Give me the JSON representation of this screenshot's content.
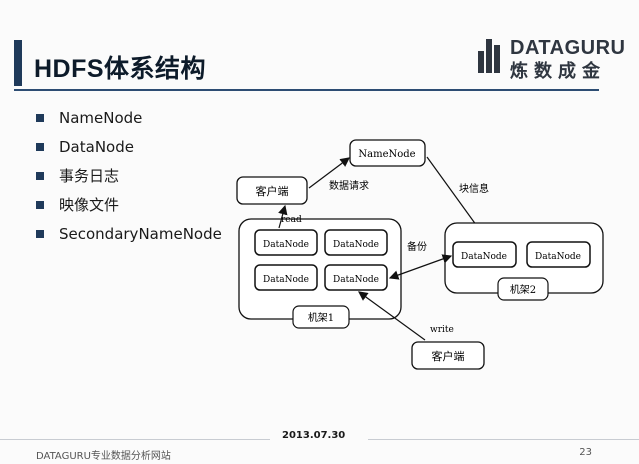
{
  "slide": {
    "title": "HDFS体系结构",
    "logo_text": "DATAGURU",
    "logo_cn": "炼数成金",
    "bullets": [
      "NameNode",
      "DataNode",
      "事务日志",
      "映像文件",
      "SecondaryNameNode"
    ],
    "footer": {
      "date": "2013.07.30",
      "left": "DATAGURU专业数据分析网站",
      "page": "23"
    },
    "colors": {
      "accent": "#1f3a5a",
      "rule": "#2d4d73"
    }
  },
  "diagram": {
    "namenode": "NameNode",
    "client_top": "客户端",
    "client_bottom": "客户端",
    "datanode": "DataNode",
    "rack1": "机架1",
    "rack2": "机架2",
    "label_request": "数据请求",
    "label_block_info": "块信息",
    "label_read": "read",
    "label_backup": "备份",
    "label_write": "write"
  }
}
